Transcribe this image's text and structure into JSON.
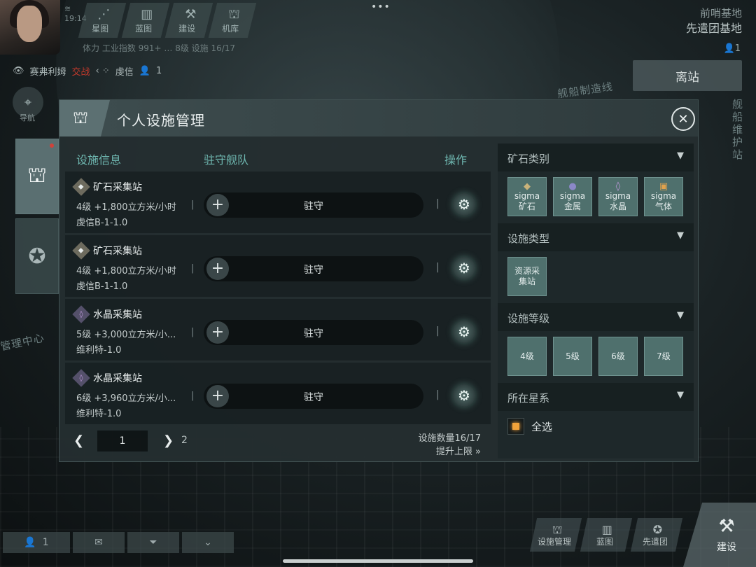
{
  "status_bar": {
    "time": "19:14"
  },
  "top_nav": {
    "tabs": [
      {
        "label": "星图",
        "icon": "star-map-icon",
        "glyph": "⋰"
      },
      {
        "label": "蓝图",
        "icon": "blueprint-icon",
        "glyph": "▥"
      },
      {
        "label": "建设",
        "icon": "hammer-icon",
        "glyph": "⚒"
      },
      {
        "label": "机库",
        "icon": "hangar-icon",
        "glyph": "⛫"
      }
    ],
    "sub_info": "体力   工业指数 991+   …   8级   设施 16/17"
  },
  "player": {
    "name": "赛弗利姆",
    "status": "交战",
    "location": "虔信",
    "count": "1"
  },
  "side": {
    "nav_label": "导航"
  },
  "top_right": {
    "subtitle": "前哨基地",
    "base_name": "先遣团基地",
    "user_count": "1",
    "leave_button": "离站"
  },
  "scene_labels": {
    "shipyard": "舰船制造线",
    "repair": "舰船维护站",
    "center": "管理中心"
  },
  "modal": {
    "title": "个人设施管理",
    "columns": {
      "info": "设施信息",
      "garrison": "驻守舰队",
      "action": "操作"
    },
    "rows": [
      {
        "name": "矿石采集站",
        "type": "ore",
        "stats": "4级 +1,800立方米/小时",
        "location": "虔信B-1-1.0",
        "garrison_label": "驻守"
      },
      {
        "name": "矿石采集站",
        "type": "ore",
        "stats": "4级 +1,800立方米/小时",
        "location": "虔信B-1-1.0",
        "garrison_label": "驻守"
      },
      {
        "name": "水晶采集站",
        "type": "crystal",
        "stats": "5级 +3,000立方米/小...",
        "location": "维利特-1.0",
        "garrison_label": "驻守"
      },
      {
        "name": "水晶采集站",
        "type": "crystal",
        "stats": "6级 +3,960立方米/小...",
        "location": "维利特-1.0",
        "garrison_label": "驻守"
      }
    ],
    "pager": {
      "current": "1",
      "total": "2",
      "count_text": "设施数量16/17",
      "upgrade_text": "提升上限 »"
    },
    "filters": {
      "ore_type": {
        "title": "矿石类别",
        "chips": [
          {
            "line1": "sigma",
            "line2": "矿石",
            "icon": "ore-icon",
            "glyph": "◆",
            "color": "#c9b27a"
          },
          {
            "line1": "sigma",
            "line2": "金属",
            "icon": "metal-icon",
            "glyph": "●",
            "color": "#8b88c8"
          },
          {
            "line1": "sigma",
            "line2": "水晶",
            "icon": "crystal-icon",
            "glyph": "◊",
            "color": "#c29be0"
          },
          {
            "line1": "sigma",
            "line2": "气体",
            "icon": "gas-icon",
            "glyph": "▣",
            "color": "#e0a24d"
          }
        ]
      },
      "facility_type": {
        "title": "设施类型",
        "chips": [
          {
            "line1": "资源采",
            "line2": "集站"
          }
        ]
      },
      "facility_level": {
        "title": "设施等级",
        "chips": [
          "4级",
          "5级",
          "6级",
          "7级"
        ]
      },
      "star_system": {
        "title": "所在星系",
        "select_all": "全选"
      }
    }
  },
  "bottom_left": {
    "user_count": "1"
  },
  "bottom_right": {
    "buttons": [
      {
        "label": "设施管理",
        "icon": "facility-icon",
        "glyph": "⛫"
      },
      {
        "label": "蓝图",
        "icon": "blueprint-icon",
        "glyph": "▥"
      },
      {
        "label": "先遣团",
        "icon": "vanguard-icon",
        "glyph": "✪"
      }
    ],
    "build_label": "建设"
  }
}
